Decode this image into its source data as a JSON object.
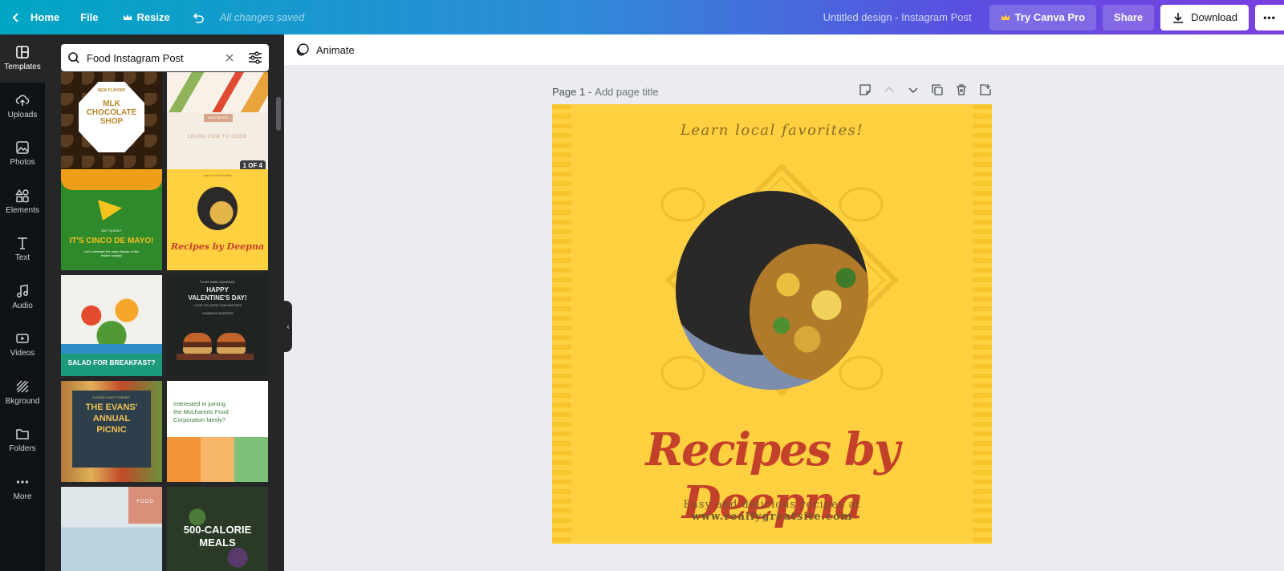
{
  "topbar": {
    "home_label": "Home",
    "file_label": "File",
    "resize_label": "Resize",
    "saved_status": "All changes saved",
    "design_title": "Untitled design - Instagram Post",
    "try_pro_label": "Try Canva Pro",
    "share_label": "Share",
    "download_label": "Download",
    "more_label": "•••"
  },
  "rail": {
    "items": [
      {
        "label": "Templates",
        "icon": "templates-icon"
      },
      {
        "label": "Uploads",
        "icon": "upload-cloud-icon"
      },
      {
        "label": "Photos",
        "icon": "photo-icon"
      },
      {
        "label": "Elements",
        "icon": "elements-shapes-icon"
      },
      {
        "label": "Text",
        "icon": "text-t-icon"
      },
      {
        "label": "Audio",
        "icon": "music-note-icon"
      },
      {
        "label": "Videos",
        "icon": "video-icon"
      },
      {
        "label": "Bkground",
        "icon": "background-stripes-icon"
      },
      {
        "label": "Folders",
        "icon": "folder-icon"
      },
      {
        "label": "More",
        "icon": "more-dots-icon"
      }
    ]
  },
  "panel": {
    "search_value": "Food Instagram Post",
    "thumbs": [
      {
        "lines": [
          "NEW FLAVOR!",
          "MLK",
          "CHOCOLATE",
          "SHOP"
        ]
      },
      {
        "lines": [
          "NEW RECIPE",
          "LEARN HOW TO COOK",
          "1 OF 4"
        ]
      },
      {
        "lines": [
          "SAY \"QUESO\"",
          "IT'S CINCO DE MAYO!",
          "Let's celebrate the many flavors of this festive holiday!"
        ]
      },
      {
        "lines": [
          "Learn local favorites!",
          "Recipes by Deepna"
        ]
      },
      {
        "lines": [
          "SALAD FOR BREAKFAST?"
        ]
      },
      {
        "lines": [
          "TO MY MAIN SQUEEZE,",
          "HAPPY",
          "VALENTINE'S DAY!",
          "I LOVE YOU MORE THAN BURGERS",
          "HOMEMADE BURGERS"
        ]
      },
      {
        "lines": [
          "PLEASE DON'T FORGET:",
          "THE EVANS'",
          "ANNUAL",
          "PICNIC"
        ]
      },
      {
        "lines": [
          "Interested in joining",
          "the Mocharinto Food",
          "Corporation family?"
        ]
      },
      {
        "lines": [
          "FOOD"
        ]
      },
      {
        "lines": [
          "500-CALORIE",
          "MEALS"
        ]
      }
    ]
  },
  "toolbar": {
    "animate_label": "Animate"
  },
  "page": {
    "number_label": "Page 1 -",
    "add_title_label": "Add page title"
  },
  "canvas": {
    "tagline": "Learn local favorites!",
    "title": "Recipes by Deepna",
    "subtitle": "Easy and delicious recipes at",
    "website": "www.reallygreatsite.com"
  },
  "colors": {
    "canvas_bg": "#ffd03f",
    "title_red": "#c3402a",
    "panel_bg": "#252627",
    "rail_bg": "#0e1318"
  }
}
